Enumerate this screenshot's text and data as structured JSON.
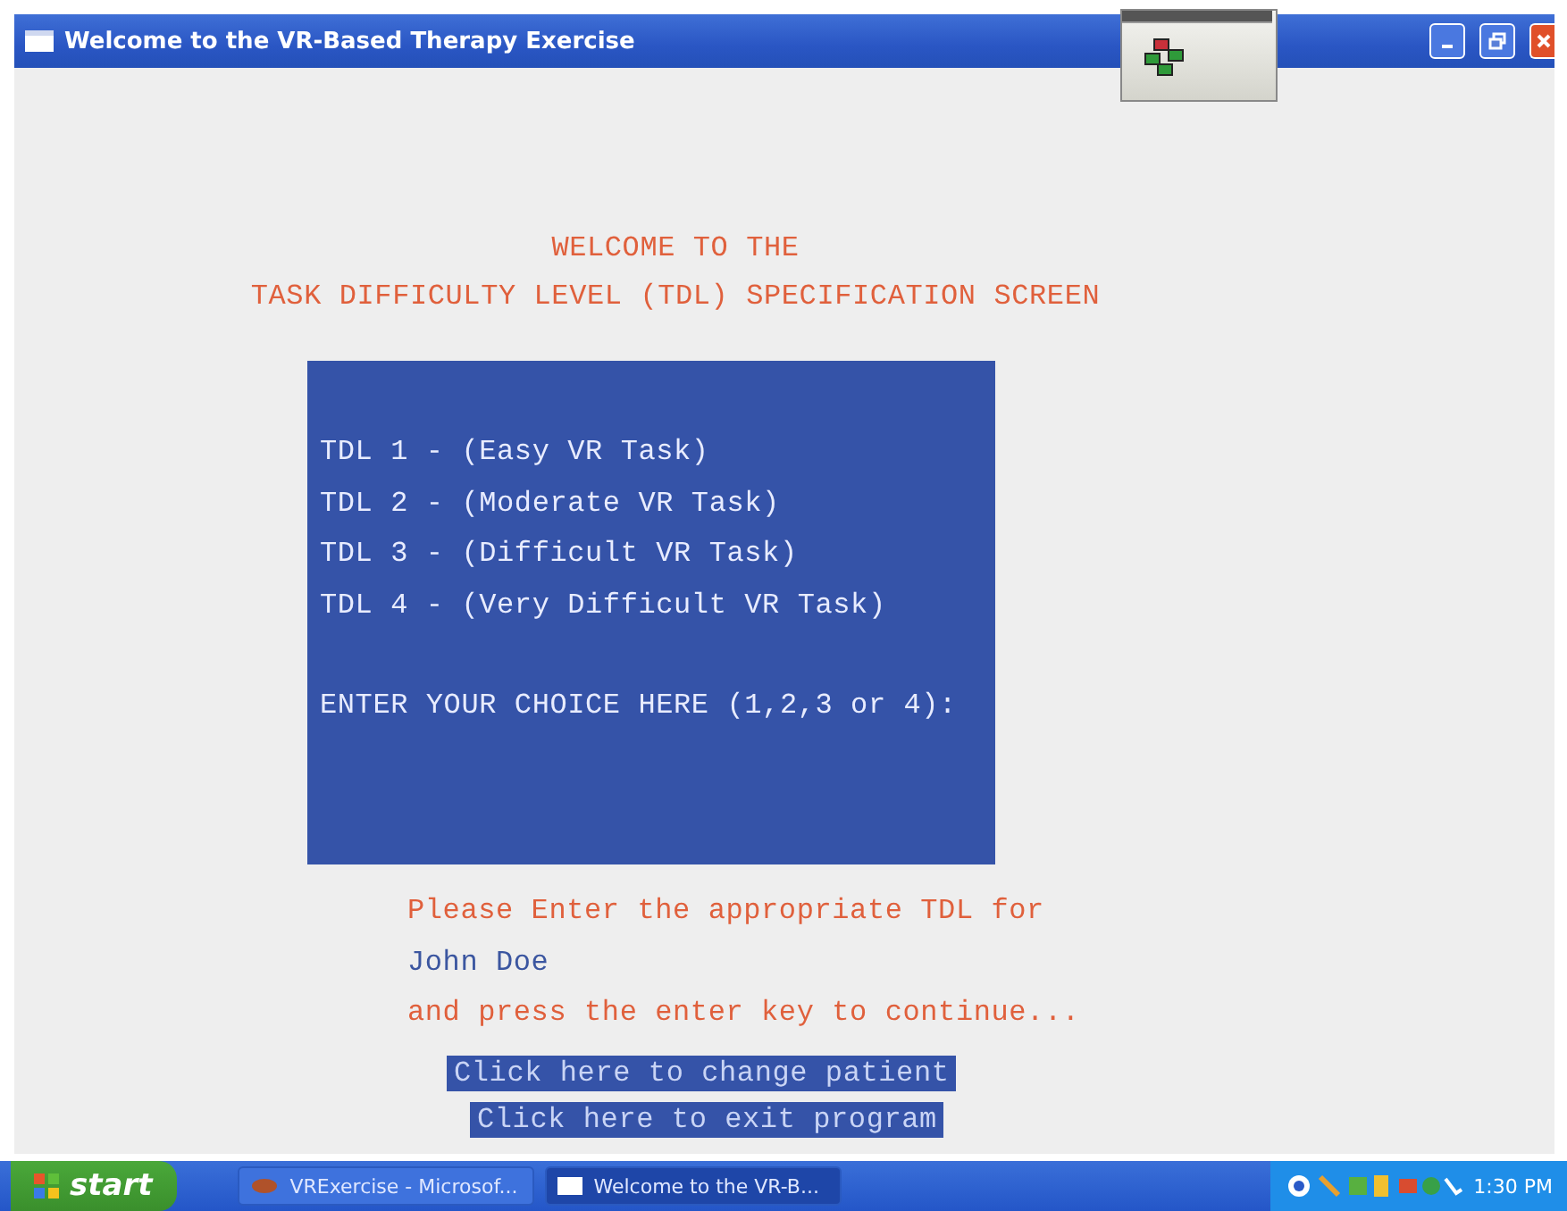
{
  "window": {
    "title": "Welcome to the VR-Based Therapy Exercise"
  },
  "heading": [
    "WELCOME TO THE",
    "TASK DIFFICULTY LEVEL (TDL) SPECIFICATION SCREEN"
  ],
  "options": [
    "TDL 1 - (Easy VR Task)",
    "TDL 2 - (Moderate VR Task)",
    "TDL 3 - (Difficult VR Task)",
    "TDL 4 - (Very Difficult VR Task)"
  ],
  "prompt": "ENTER YOUR CHOICE HERE (1,2,3 or 4):",
  "instruction": "Please Enter the appropriate TDL for",
  "patient_name": "John Doe",
  "continue_hint": "and press the enter key to continue...",
  "buttons": [
    "Click here to change patient",
    "Click here to exit program"
  ],
  "taskbar": {
    "start": "start",
    "tasks": [
      {
        "label": "VRExercise - Microsof...",
        "selected": false
      },
      {
        "label": "Welcome to the VR-B...",
        "selected": true
      }
    ],
    "clock": "1:30 PM"
  }
}
